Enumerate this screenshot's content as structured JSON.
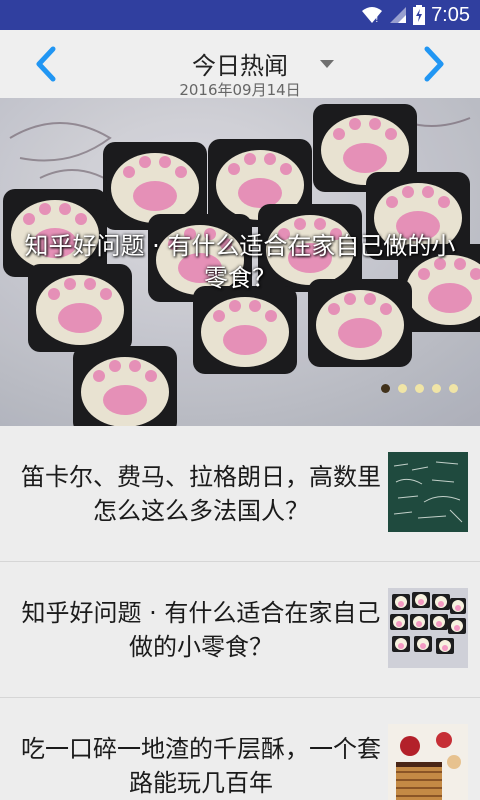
{
  "status": {
    "time": "7:05"
  },
  "header": {
    "title": "今日热闻",
    "date": "2016年09月14日",
    "prev_icon": "chevron-left-icon",
    "next_icon": "chevron-right-icon",
    "accent": "#2196f3"
  },
  "banner": {
    "title": "知乎好问题 · 有什么适合在家自己做的小\n零食？",
    "slide_count": 5,
    "active_slide": 0
  },
  "stories": [
    {
      "title": "笛卡尔、费马、拉格朗日，高数里怎么这么多法国人？"
    },
    {
      "title": "知乎好问题 · 有什么适合在家自己做的小零食？"
    },
    {
      "title": "吃一口碎一地渣的千层酥，一个套路能玩几百年"
    }
  ]
}
